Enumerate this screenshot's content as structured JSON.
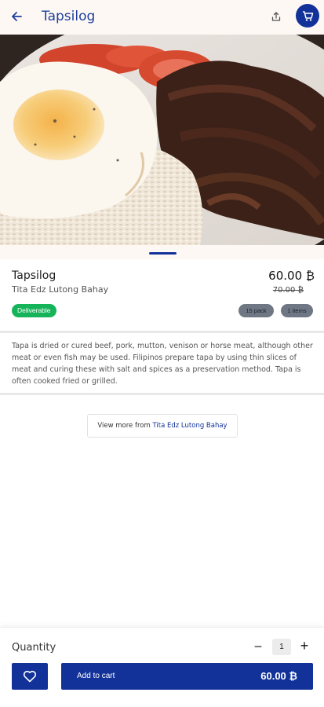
{
  "header": {
    "title": "Tapsilog",
    "icons": {
      "back": "arrow-left-icon",
      "share": "share-icon",
      "cart": "cart-icon"
    },
    "accent_color": "#12329a"
  },
  "product": {
    "name": "Tapsilog",
    "vendor": "Tita Edz Lutong Bahay",
    "price": "60.00 ₿",
    "old_price": "70.00 ₿",
    "deliverable_badge": "Deliverable",
    "tags": [
      "15 pack",
      "1 items"
    ],
    "description": "Tapa is dried or cured beef, pork, mutton, venison or horse meat, although other meat or even fish may be used. Filipinos prepare tapa by using thin slices of meat and curing these with salt and spices as a preservation method. Tapa is often cooked fried or grilled."
  },
  "view_more": {
    "prefix": "View more from ",
    "store": "Tita Edz Lutong Bahay"
  },
  "bottom_bar": {
    "quantity_label": "Quantity",
    "quantity_value": "1",
    "minus": "−",
    "plus": "+",
    "add_to_cart_label": "Add to cart",
    "add_to_cart_amount": "60.00 ₿",
    "favorite_icon": "heart-icon"
  },
  "colors": {
    "primary": "#12329a",
    "deliverable": "#16b45a",
    "tag": "#6f7784"
  }
}
